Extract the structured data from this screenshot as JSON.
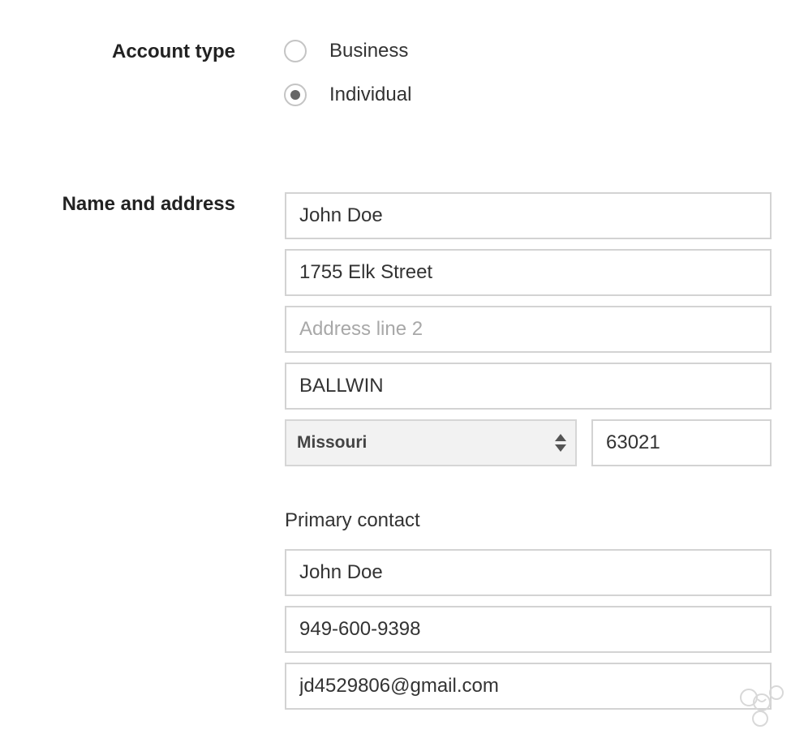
{
  "account_type": {
    "label": "Account type",
    "options": [
      {
        "label": "Business",
        "checked": false
      },
      {
        "label": "Individual",
        "checked": true
      }
    ]
  },
  "name_and_address": {
    "label": "Name and address",
    "name": {
      "value": "John Doe",
      "placeholder": ""
    },
    "address_line_1": {
      "value": "1755 Elk Street",
      "placeholder": ""
    },
    "address_line_2": {
      "value": "",
      "placeholder": "Address line 2"
    },
    "city": {
      "value": "BALLWIN",
      "placeholder": ""
    },
    "state": {
      "selected": "Missouri"
    },
    "zip": {
      "value": "63021",
      "placeholder": ""
    }
  },
  "primary_contact": {
    "heading": "Primary contact",
    "name": {
      "value": "John Doe",
      "placeholder": ""
    },
    "phone": {
      "value": "949-600-9398",
      "placeholder": ""
    },
    "email": {
      "value": "jd4529806@gmail.com",
      "placeholder": ""
    }
  },
  "colors": {
    "border": "#d3d3d3",
    "select_background": "#f2f2f2",
    "placeholder": "#a8a8a8",
    "text": "#333333"
  },
  "icons": {
    "select_arrows": "up-down-arrows-icon",
    "watermark": "watermark-logo-icon"
  }
}
